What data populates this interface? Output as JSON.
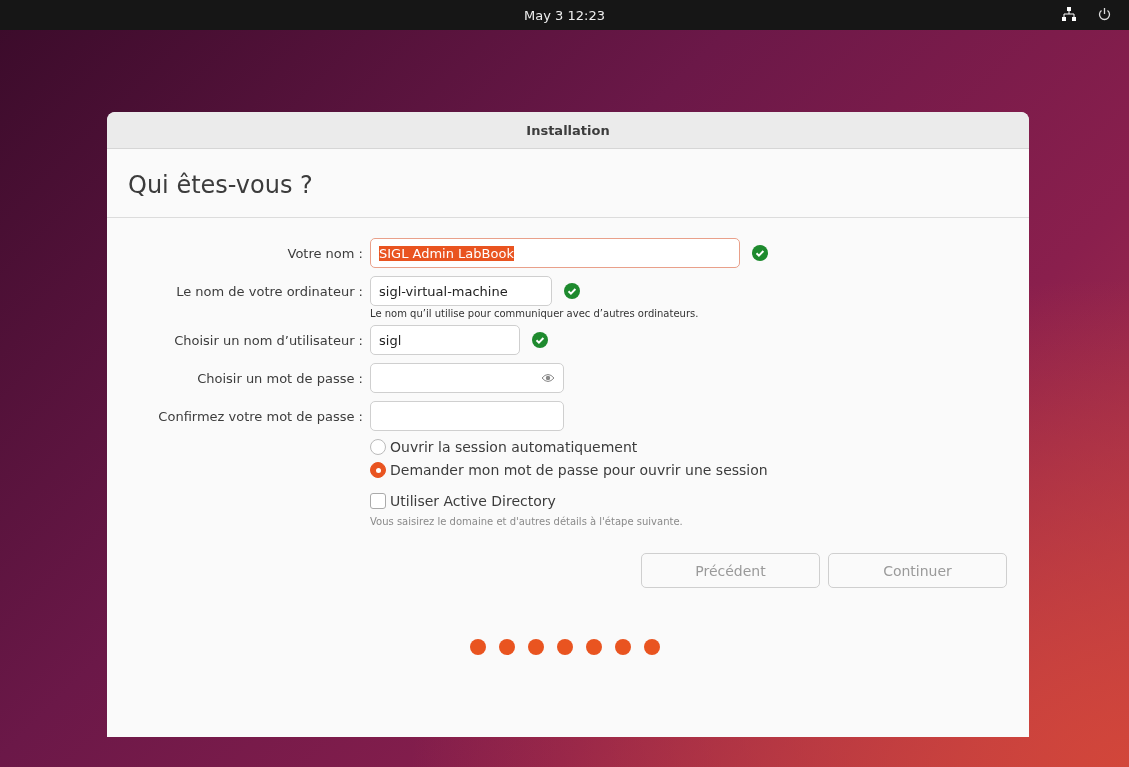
{
  "top_bar": {
    "clock": "May 3  12:23"
  },
  "window": {
    "title": "Installation",
    "heading": "Qui êtes-vous ?"
  },
  "fields": [
    {
      "label": "Votre nom :",
      "kind": "text",
      "value": "SIGL Admin LabBook",
      "focused": true,
      "valid": true
    },
    {
      "label": "Le nom de votre ordinateur :",
      "kind": "text",
      "value": "sigl-virtual-machine",
      "focused": false,
      "valid": true,
      "hint": "Le nom qu’il utilise pour communiquer avec d’autres ordinateurs."
    },
    {
      "label": "Choisir un nom d’utilisateur :",
      "kind": "text",
      "value": "sigl",
      "focused": false,
      "valid": true
    },
    {
      "label": "Choisir un mot de passe :",
      "kind": "password",
      "focused": false,
      "valid": false
    },
    {
      "label": "Confirmez votre mot de passe :",
      "kind": "plain",
      "focused": false,
      "valid": false
    }
  ],
  "login_options": [
    {
      "label": "Ouvrir la session automatiquement",
      "selected": false
    },
    {
      "label": "Demander mon mot de passe pour ouvrir une session",
      "selected": true
    }
  ],
  "active_directory": {
    "label": "Utiliser Active Directory",
    "checked": false,
    "hint": "Vous saisirez le domaine et d'autres détails à l'étape suivante."
  },
  "buttons": [
    {
      "label": "Précédent",
      "disabled": true
    },
    {
      "label": "Continuer",
      "disabled": true
    }
  ],
  "progress_dots": [
    {
      "done": true
    },
    {
      "done": true
    },
    {
      "done": true
    },
    {
      "done": true
    },
    {
      "done": true
    },
    {
      "done": true
    },
    {
      "done": true
    }
  ]
}
